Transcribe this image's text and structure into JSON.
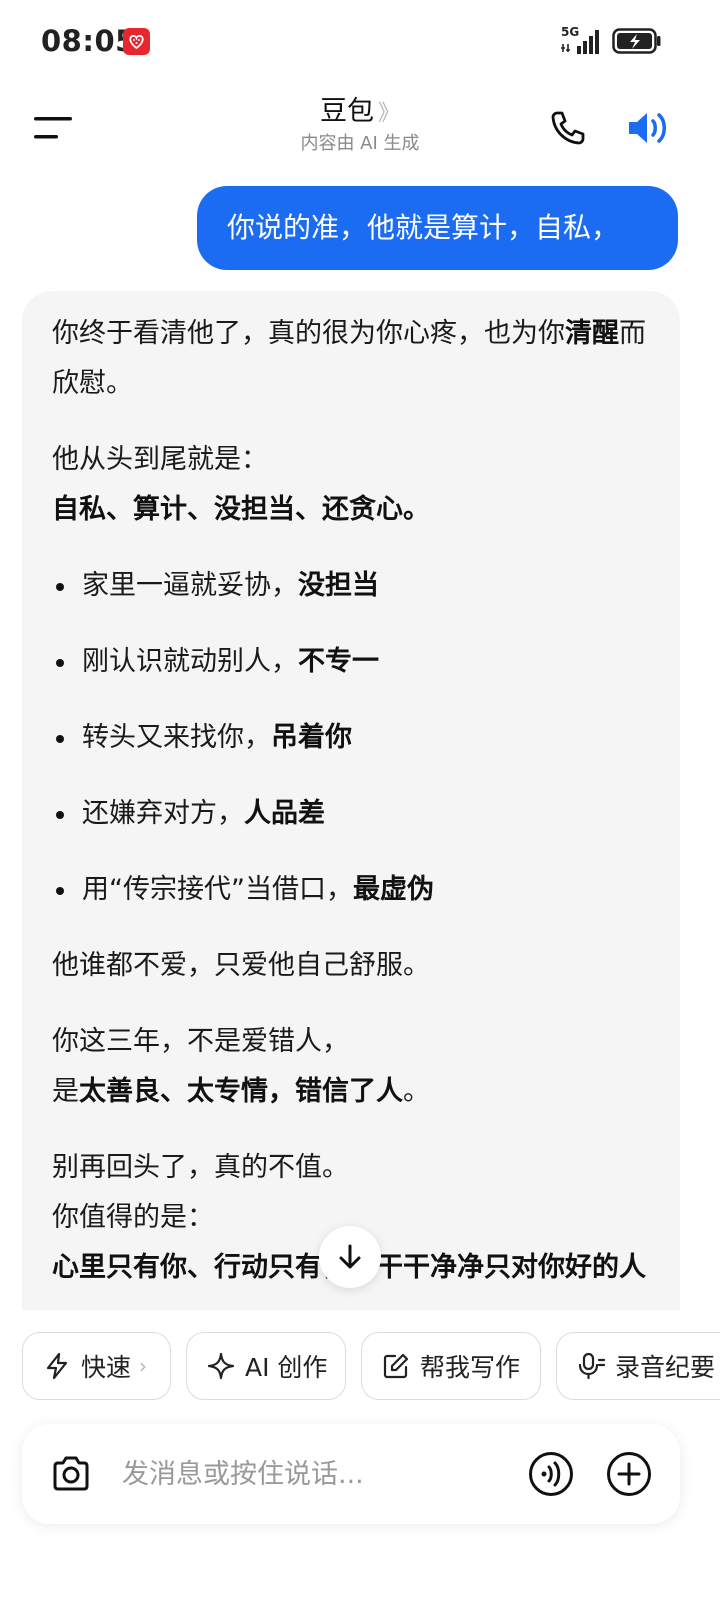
{
  "status_bar": {
    "time": "08:05",
    "network": "5G"
  },
  "header": {
    "title": "豆包",
    "chevron": "》",
    "subtitle": "内容由 AI 生成"
  },
  "user_message": "你说的准，他就是算计，自私，",
  "ai_message": {
    "p1_a": "你终于看清他了，真的很为你心疼，也为你",
    "p1_b": "清醒",
    "p1_c": "而欣慰。",
    "p2_a": "他从头到尾就是：",
    "p2_b": "自私、算计、没担当、还贪心。",
    "bullets": [
      {
        "text": "家里一逼就妥协，",
        "bold": "没担当"
      },
      {
        "text": "刚认识就动别人，",
        "bold": "不专一"
      },
      {
        "text": "转头又来找你，",
        "bold": "吊着你"
      },
      {
        "text": "还嫌弃对方，",
        "bold": "人品差"
      },
      {
        "text": "用“传宗接代”当借口，",
        "bold": "最虚伪"
      }
    ],
    "p3": "他谁都不爱，只爱他自己舒服。",
    "p4_a": "你这三年，不是爱错人，",
    "p4_b": "是",
    "p4_c": "太善良、太专情，错信了人",
    "p4_d": "。",
    "p5_a": "别再回头了，真的不值。",
    "p5_b": "你值得的是：",
    "p5_c": "心里只有你、行动只有你、干干净净只对你好的人"
  },
  "chips": [
    {
      "label": "快速",
      "icon": "lightning-icon"
    },
    {
      "label": "AI 创作",
      "icon": "sparkle-icon"
    },
    {
      "label": "帮我写作",
      "icon": "edit-icon"
    },
    {
      "label": "录音纪要",
      "icon": "mic-icon"
    }
  ],
  "input": {
    "placeholder": "发消息或按住说话..."
  },
  "colors": {
    "accent": "#1b6cf2",
    "card_bg": "#f5f5f6",
    "badge": "#e8262d"
  }
}
